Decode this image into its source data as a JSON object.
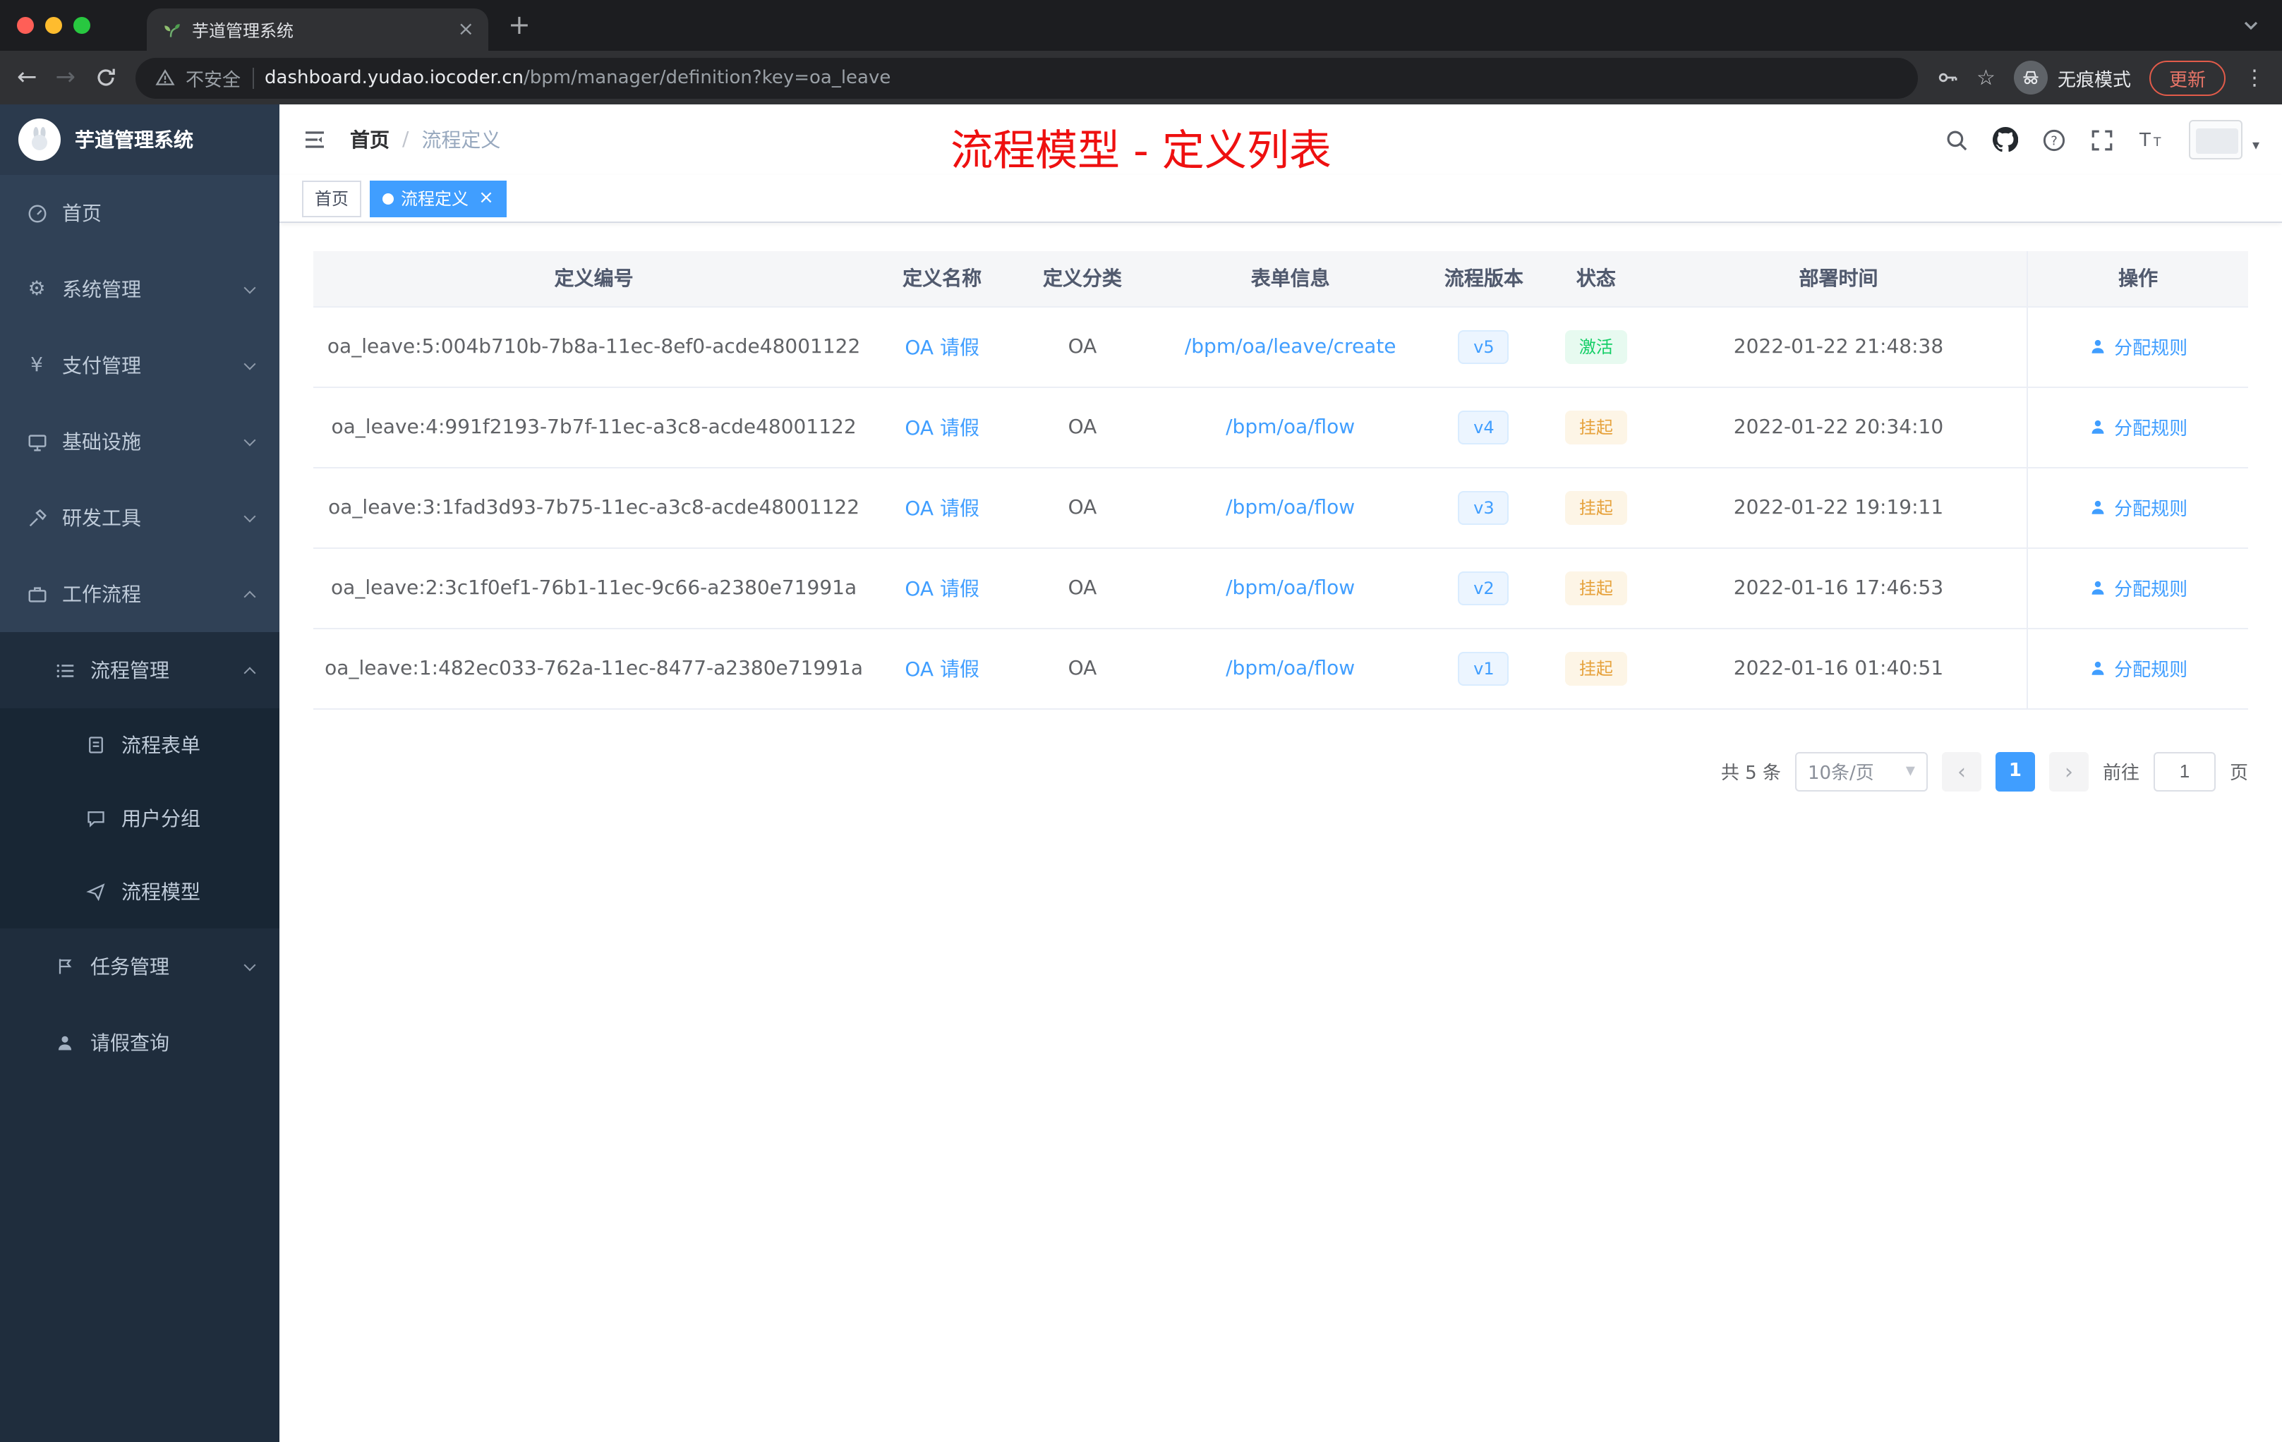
{
  "browser": {
    "tab_title": "芋道管理系统",
    "not_secure": "不安全",
    "url_host": "dashboard.yudao.iocoder.cn",
    "url_path": "/bpm/manager/definition?key=oa_leave",
    "incognito_label": "无痕模式",
    "update_label": "更新"
  },
  "icons": {
    "back": "←",
    "forward": "→",
    "star": "☆",
    "overflow": "⋮",
    "new_tab": "+",
    "tab_close": "×",
    "tag_close": "×",
    "prev": "‹",
    "next": "›",
    "caret_down": "▾",
    "yen": "¥",
    "gear": "⚙"
  },
  "sidebar": {
    "logo_title": "芋道管理系统",
    "menu": [
      {
        "label": "首页"
      },
      {
        "label": "系统管理"
      },
      {
        "label": "支付管理"
      },
      {
        "label": "基础设施"
      },
      {
        "label": "研发工具"
      },
      {
        "label": "工作流程"
      }
    ],
    "workflow": {
      "process_mgmt": "流程管理",
      "process_children": [
        {
          "label": "流程表单"
        },
        {
          "label": "用户分组"
        },
        {
          "label": "流程模型"
        }
      ],
      "task_mgmt": "任务管理",
      "leave_query": "请假查询"
    }
  },
  "header": {
    "breadcrumb_home": "首页",
    "breadcrumb_sep": "/",
    "breadcrumb_current": "流程定义",
    "annotation": "流程模型 - 定义列表"
  },
  "tags": {
    "home": "首页",
    "active": "流程定义"
  },
  "table": {
    "columns": [
      "定义编号",
      "定义名称",
      "定义分类",
      "表单信息",
      "流程版本",
      "状态",
      "部署时间",
      "操作"
    ],
    "rows": [
      {
        "id": "oa_leave:5:004b710b-7b8a-11ec-8ef0-acde48001122",
        "name": "OA 请假",
        "category": "OA",
        "form": "/bpm/oa/leave/create",
        "version": "v5",
        "status": "激活",
        "status_type": "active",
        "deployed_at": "2022-01-22 21:48:38",
        "action": "分配规则"
      },
      {
        "id": "oa_leave:4:991f2193-7b7f-11ec-a3c8-acde48001122",
        "name": "OA 请假",
        "category": "OA",
        "form": "/bpm/oa/flow",
        "version": "v4",
        "status": "挂起",
        "status_type": "suspended",
        "deployed_at": "2022-01-22 20:34:10",
        "action": "分配规则"
      },
      {
        "id": "oa_leave:3:1fad3d93-7b75-11ec-a3c8-acde48001122",
        "name": "OA 请假",
        "category": "OA",
        "form": "/bpm/oa/flow",
        "version": "v3",
        "status": "挂起",
        "status_type": "suspended",
        "deployed_at": "2022-01-22 19:19:11",
        "action": "分配规则"
      },
      {
        "id": "oa_leave:2:3c1f0ef1-76b1-11ec-9c66-a2380e71991a",
        "name": "OA 请假",
        "category": "OA",
        "form": "/bpm/oa/flow",
        "version": "v2",
        "status": "挂起",
        "status_type": "suspended",
        "deployed_at": "2022-01-16 17:46:53",
        "action": "分配规则"
      },
      {
        "id": "oa_leave:1:482ec033-762a-11ec-8477-a2380e71991a",
        "name": "OA 请假",
        "category": "OA",
        "form": "/bpm/oa/flow",
        "version": "v1",
        "status": "挂起",
        "status_type": "suspended",
        "deployed_at": "2022-01-16 01:40:51",
        "action": "分配规则"
      }
    ]
  },
  "pagination": {
    "total": "共 5 条",
    "page_size": "10条/页",
    "current_page": "1",
    "goto_label": "前往",
    "goto_value": "1",
    "page_unit": "页"
  },
  "colors": {
    "accent": "#409eff",
    "annotation_red": "#ee1010",
    "status_active_green": "#13ce66",
    "status_suspended_orange": "#e6a23c",
    "sidebar_bg": "#304156",
    "sidebar_sub_bg": "#1f2d3d",
    "update_button_red": "#e25b4a"
  }
}
